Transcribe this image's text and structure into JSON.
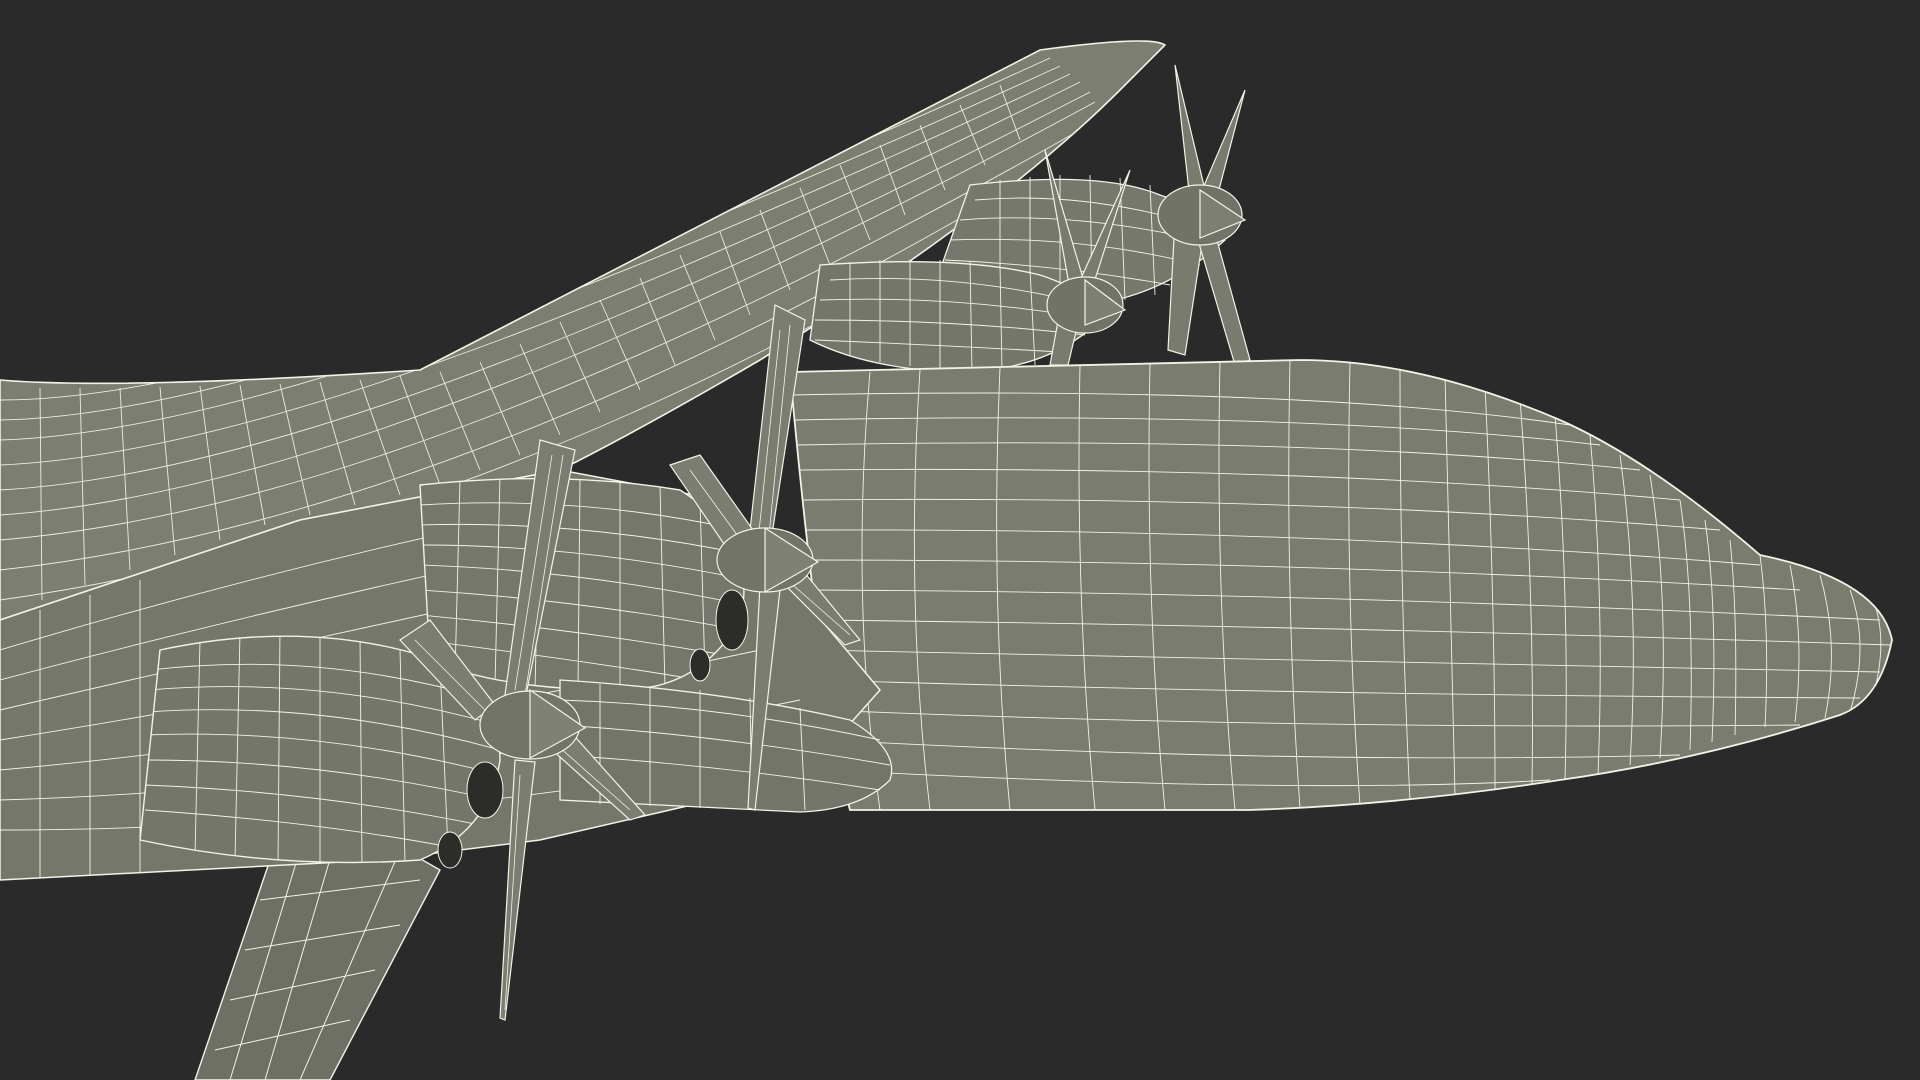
{
  "scene": {
    "subject": "wireframe-render",
    "colors": {
      "background": "#2a2a2a",
      "surface": "#7a7b6e",
      "surface_light": "#8a8b7e",
      "surface_dark": "#5e5f55",
      "wire": "#f3f2e6",
      "shadow": "#2c2c28"
    }
  }
}
